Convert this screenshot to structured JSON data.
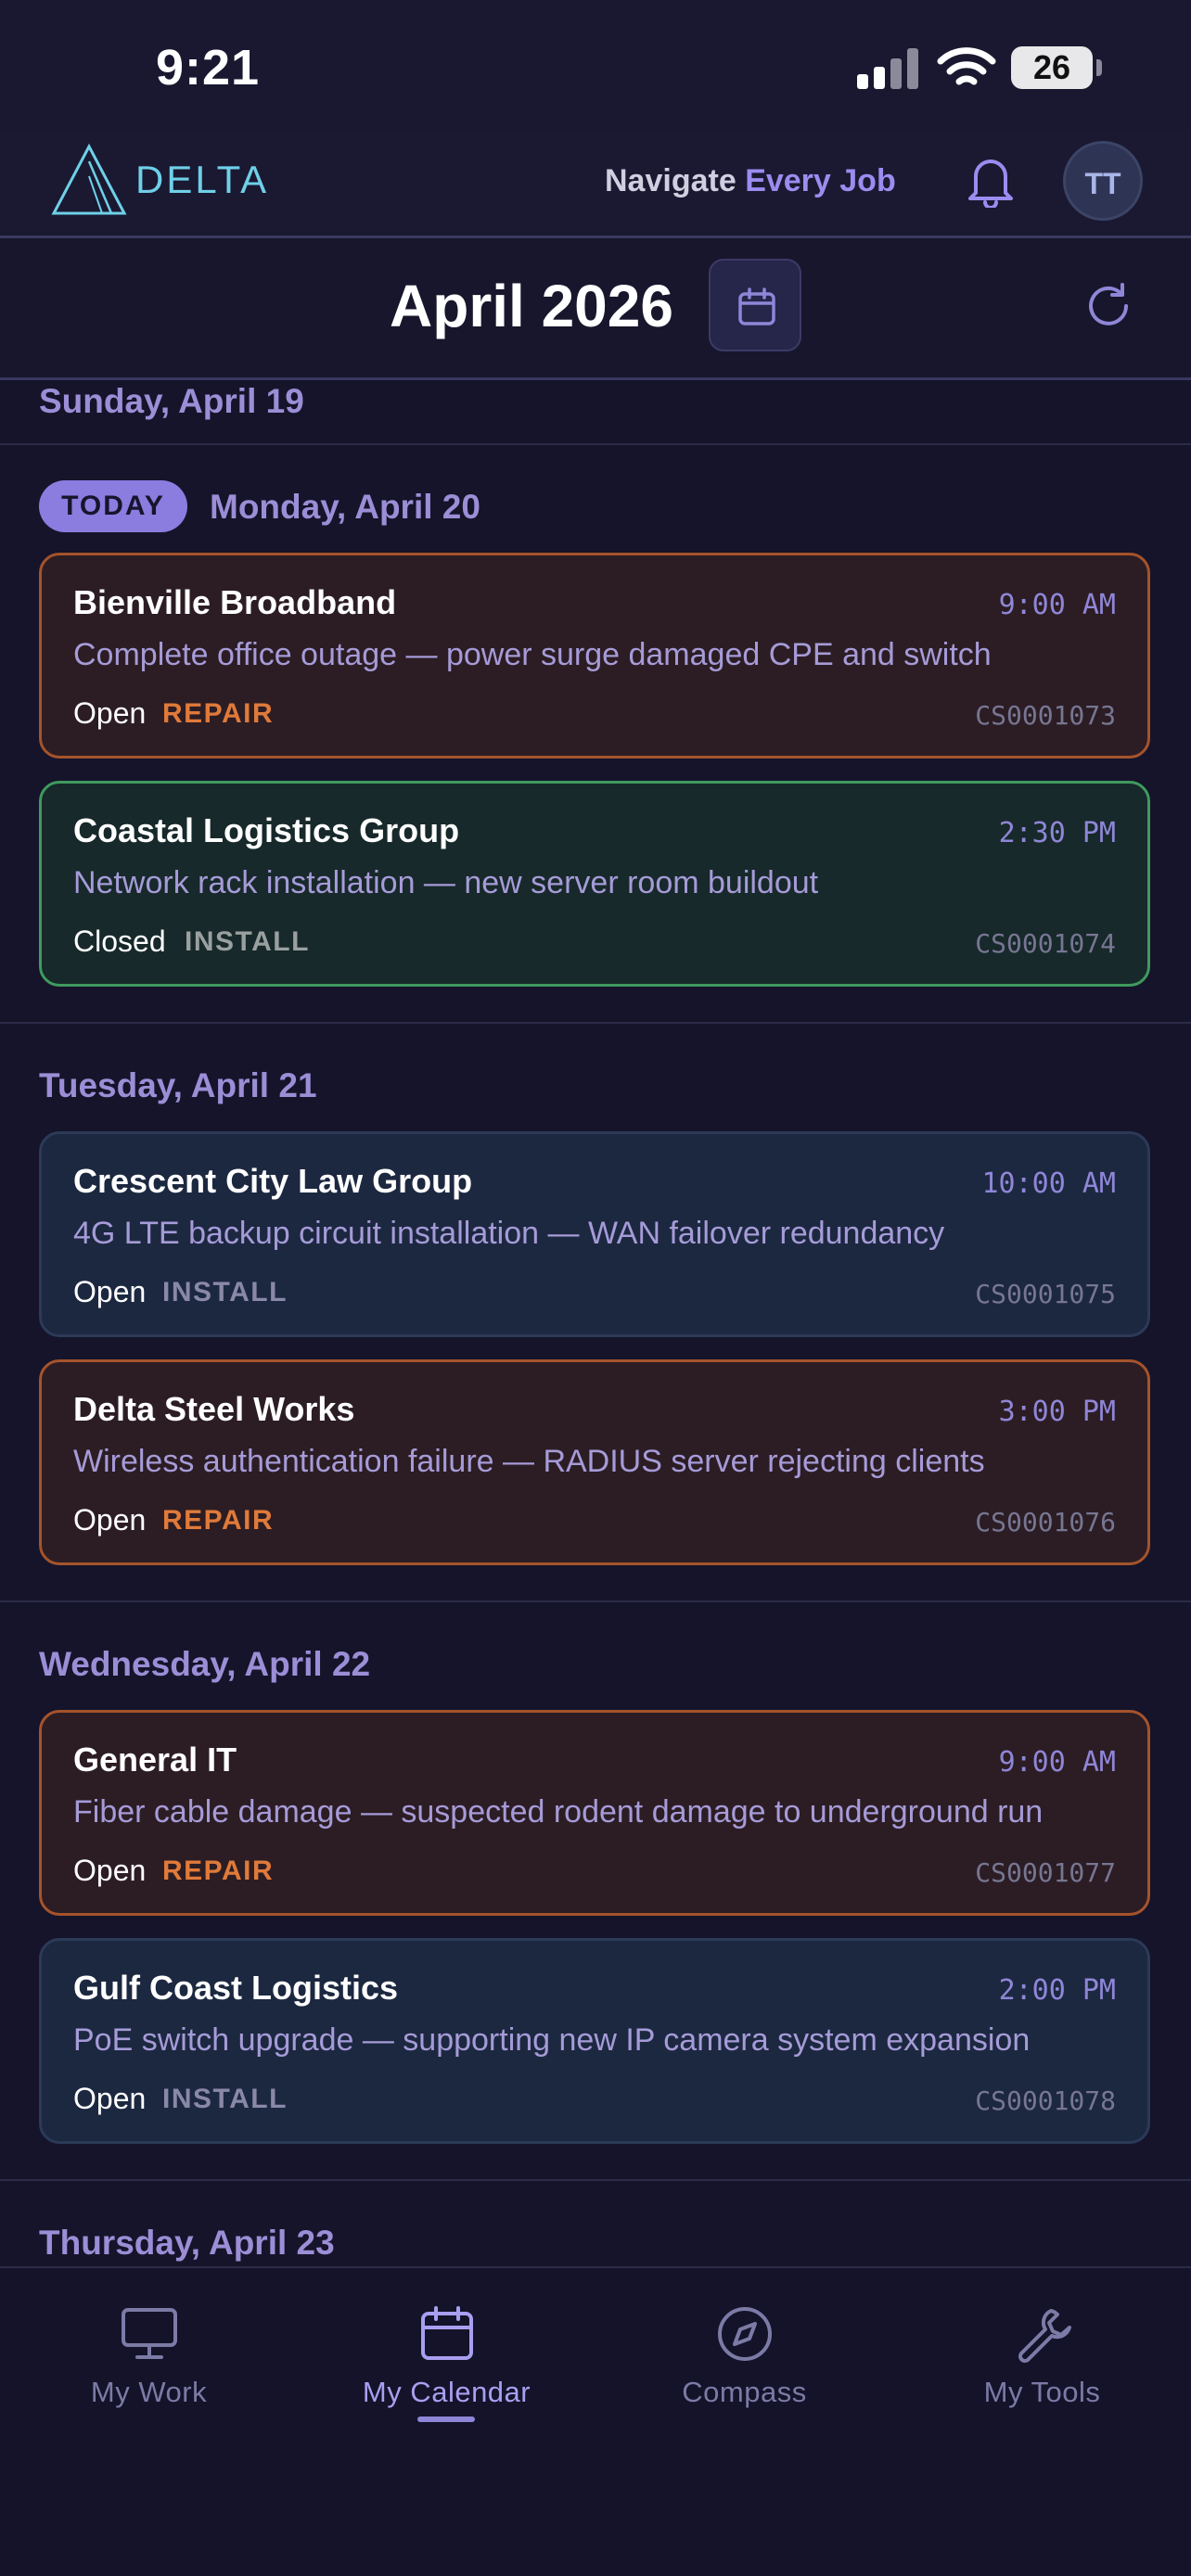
{
  "status_bar": {
    "time": "9:21",
    "battery": "26"
  },
  "header": {
    "logo_text": "DELTA",
    "tagline_part1": "Navigate ",
    "tagline_part2": "Every Job",
    "avatar_initials": "TT"
  },
  "month_bar": {
    "title": "April 2026"
  },
  "schedule": {
    "today_badge": "TODAY",
    "days": [
      {
        "heading": "Sunday, April 19"
      },
      {
        "heading": "Monday, April 20"
      },
      {
        "heading": "Tuesday, April 21"
      },
      {
        "heading": "Wednesday, April 22"
      },
      {
        "heading": "Thursday, April 23"
      }
    ],
    "jobs": [
      {
        "company": "Bienville Broadband",
        "time": "9:00 AM",
        "description": "Complete office outage — power surge damaged CPE and switch",
        "status": "Open",
        "type": "REPAIR",
        "case": "CS0001073"
      },
      {
        "company": "Coastal Logistics Group",
        "time": "2:30 PM",
        "description": "Network rack installation — new server room buildout",
        "status": "Closed",
        "type": "INSTALL",
        "case": "CS0001074"
      },
      {
        "company": "Crescent City Law Group",
        "time": "10:00 AM",
        "description": "4G LTE backup circuit installation — WAN failover redundancy",
        "status": "Open",
        "type": "INSTALL",
        "case": "CS0001075"
      },
      {
        "company": "Delta Steel Works",
        "time": "3:00 PM",
        "description": "Wireless authentication failure — RADIUS server rejecting clients",
        "status": "Open",
        "type": "REPAIR",
        "case": "CS0001076"
      },
      {
        "company": "General IT",
        "time": "9:00 AM",
        "description": "Fiber cable damage — suspected rodent damage to underground run",
        "status": "Open",
        "type": "REPAIR",
        "case": "CS0001077"
      },
      {
        "company": "Gulf Coast Logistics",
        "time": "2:00 PM",
        "description": "PoE switch upgrade — supporting new IP camera system expansion",
        "status": "Open",
        "type": "INSTALL",
        "case": "CS0001078"
      }
    ]
  },
  "nav": {
    "items": [
      {
        "label": "My Work"
      },
      {
        "label": "My Calendar"
      },
      {
        "label": "Compass"
      },
      {
        "label": "My Tools"
      }
    ]
  },
  "colors": {
    "accent": "#8b7ce0",
    "repair": "#e07a3a",
    "closed_border": "#3f9a5e",
    "logo": "#6fd0e8"
  }
}
